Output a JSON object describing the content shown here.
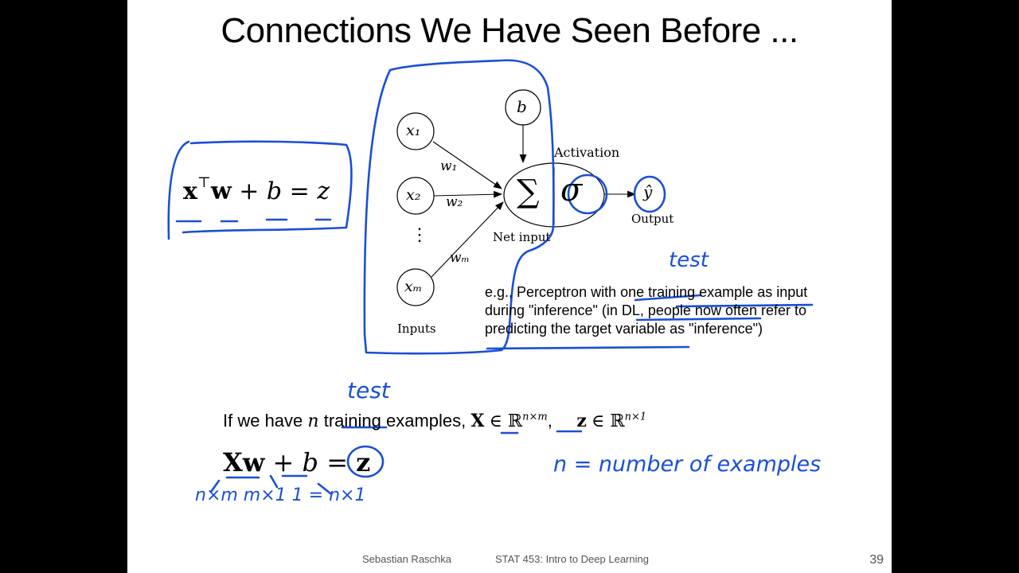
{
  "title": "Connections We Have Seen Before ...",
  "diagram": {
    "inputs": [
      "x₁",
      "x₂",
      "⋮",
      "xₘ"
    ],
    "weights": [
      "w₁",
      "w₂",
      "wₘ"
    ],
    "bias": "b",
    "sum_symbol": "∑",
    "activation_symbol": "σ",
    "output_symbol": "ŷ",
    "labels": {
      "activation": "Activation",
      "output": "Output",
      "net_input": "Net input",
      "inputs": "Inputs"
    }
  },
  "left_equation": {
    "x": "x",
    "transpose": "⊤",
    "w": "w",
    "rest": "+ b = z"
  },
  "note": {
    "line1": "e.g., Perceptron with one training example as input",
    "line2": "during \"inference\" (in DL, people now often refer to",
    "line3": "predicting the target variable as \"inference\")"
  },
  "line_n": {
    "pre": "If we have",
    "n": "n",
    "mid": "training examples,",
    "X": "X",
    "in1": "∈ ℝ",
    "sup1": "n×m",
    "comma": ",",
    "z": "z",
    "in2": "∈ ℝ",
    "sup2": "n×1"
  },
  "bottom_equation": {
    "Xw": "Xw",
    "plus_b": "+ b =",
    "z": "z"
  },
  "handwriting": {
    "test_top": "test",
    "test_bottom": "test",
    "n_def": "n = number of examples",
    "dims": "n×m   m×1   1 = n×1"
  },
  "footer": {
    "author": "Sebastian Raschka",
    "course": "STAT 453: Intro to Deep Learning",
    "page": "39"
  },
  "colors": {
    "ink": "#1a4fd6",
    "background": "#000000",
    "slide": "#ffffff"
  }
}
